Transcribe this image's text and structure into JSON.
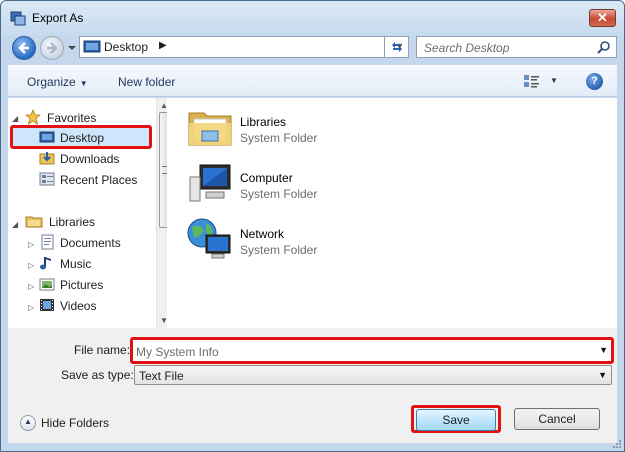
{
  "window": {
    "title": "Export As"
  },
  "nav": {
    "address_text": "Desktop",
    "search_placeholder": "Search Desktop"
  },
  "toolbar": {
    "organize_label": "Organize",
    "new_folder_label": "New folder"
  },
  "sidebar": {
    "groups": [
      {
        "label": "Favorites",
        "icon": "star-icon",
        "items": [
          {
            "label": "Desktop",
            "icon": "desktop-icon",
            "selected": true
          },
          {
            "label": "Downloads",
            "icon": "downloads-icon"
          },
          {
            "label": "Recent Places",
            "icon": "recent-places-icon"
          }
        ]
      },
      {
        "label": "Libraries",
        "icon": "libraries-icon",
        "items": [
          {
            "label": "Documents",
            "icon": "documents-icon"
          },
          {
            "label": "Music",
            "icon": "music-icon"
          },
          {
            "label": "Pictures",
            "icon": "pictures-icon"
          },
          {
            "label": "Videos",
            "icon": "videos-icon"
          }
        ]
      }
    ]
  },
  "content": {
    "items": [
      {
        "name": "Libraries",
        "type": "System Folder",
        "icon": "libraries-folder-icon"
      },
      {
        "name": "Computer",
        "type": "System Folder",
        "icon": "computer-icon"
      },
      {
        "name": "Network",
        "type": "System Folder",
        "icon": "network-icon"
      }
    ]
  },
  "form": {
    "file_name_label": "File name:",
    "file_name_value": "My System Info",
    "save_type_label": "Save as type:",
    "save_type_value": "Text File"
  },
  "footer": {
    "hide_folders_label": "Hide Folders",
    "save_label": "Save",
    "cancel_label": "Cancel"
  },
  "colors": {
    "highlight_border": "#e21212",
    "selection_fill": "#cde6fb",
    "window_frame": "#c4d7ec"
  }
}
